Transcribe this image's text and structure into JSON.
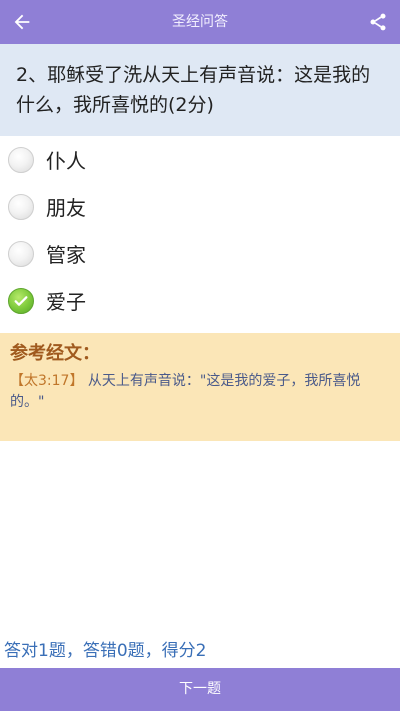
{
  "header": {
    "title": "圣经问答",
    "back_icon": "arrow-left-icon",
    "share_icon": "share-icon"
  },
  "question": {
    "text": "2、耶稣受了洗从天上有声音说：这是我的什么，我所喜悦的(2分)"
  },
  "options": [
    {
      "label": "仆人",
      "selected": false
    },
    {
      "label": "朋友",
      "selected": false
    },
    {
      "label": "管家",
      "selected": false
    },
    {
      "label": "爱子",
      "selected": true
    }
  ],
  "reference": {
    "heading": "参考经文：",
    "citation": "【太3:17】",
    "text": "从天上有声音说：\"这是我的爱子，我所喜悦的。\""
  },
  "score": {
    "text": "答对1题，答错0题，得分2"
  },
  "footer": {
    "next_label": "下一题"
  },
  "colors": {
    "accent": "#8f7fd6",
    "question_bg": "#dfe8f4",
    "reference_bg": "#fbe6b7",
    "score_text": "#3a6fb7",
    "check_green": "#7cc93a"
  }
}
